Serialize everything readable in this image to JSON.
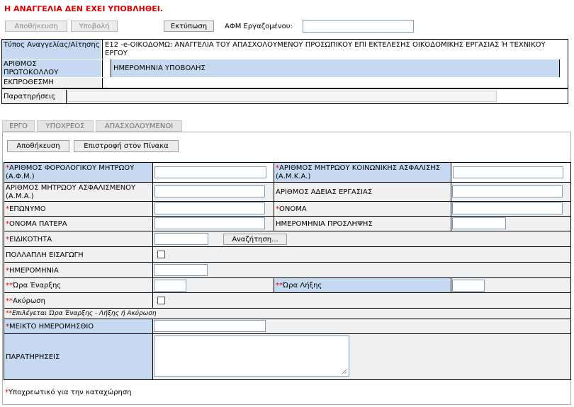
{
  "status_message": "Η ΑΝΑΓΓΕΛΙΑ ΔΕΝ ΕΧΕΙ ΥΠΟΒΛΗΘΕΙ.",
  "toolbar": {
    "save_label": "Αποθήκευση",
    "submit_label": "Υποβολή",
    "print_label": "Εκτύπωση",
    "afm_label": "ΑΦΜ Εργαζομένου:",
    "afm_value": ""
  },
  "header": {
    "type_label": "Τύπος Αναγγελίας/Αίτησης",
    "type_value": "Ε12 -e-ΟΙΚΟΔΟΜΩ: ΑΝΑΓΓΕΛΙΑ ΤΟΥ ΑΠΑΣΧΟΛΟΥΜΕΝΟΥ ΠΡΟΣΩΠΙΚΟΥ ΕΠΙ ΕΚΤΕΛΕΣΗΣ ΟΙΚΟΔΟΜΙΚΗΣ ΕΡΓΑΣΙΑΣ Ή ΤΕΧΝΙΚΟΥ ΕΡΓΟΥ",
    "protocol_label": "ΑΡΙΘΜΟΣ ΠΡΩΤΟΚΟΛΛΟΥ",
    "submission_date_label": "ΗΜΕΡΟΜΗΝΙΑ ΥΠΟΒΟΛΗΣ",
    "late_label": "ΕΚΠΡΟΘΕΣΜΗ",
    "notes_label": "Παρατηρήσεις"
  },
  "tabs": [
    "ΕΡΓΟ",
    "ΥΠΟΧΡΕΟΣ",
    "ΑΠΑΣΧΟΛΟΥΜΕΝΟΙ"
  ],
  "form_toolbar": {
    "save_label": "Αποθήκευση",
    "back_label": "Επιστροφή στον Πίνακα"
  },
  "form": {
    "afm_label": "ΑΡΙΘΜΟΣ ΦΟΡΟΛΟΓΙΚΟΥ ΜΗΤΡΩΟΥ (Α.Φ.Μ.)",
    "amka_label": "ΑΡΙΘΜΟΣ ΜΗΤΡΩΟΥ ΚΟΙΝΩΝΙΚΗΣ ΑΣΦΑΛΙΣΗΣ (Α.Μ.Κ.Α.)",
    "ama_label": "ΑΡΙΘΜΟΣ ΜΗΤΡΩΟΥ ΑΣΦΑΛΙΣΜΕΝΟΥ (Α.Μ.Α.)",
    "work_permit_label": "ΑΡΙΘΜΟΣ ΑΔΕΙΑΣ ΕΡΓΑΣΙΑΣ",
    "surname_label": "ΕΠΩΝΥΜΟ",
    "name_label": "ΟΝΟΜΑ",
    "father_name_label": "ΟΝΟΜΑ ΠΑΤΕΡΑ",
    "hire_date_label": "ΗΜΕΡΟΜΗΝΙΑ ΠΡΟΣΛΗΨΗΣ",
    "specialty_label": "ΕΙΔΙΚΟΤΗΤΑ",
    "search_label": "Αναζήτηση...",
    "multi_entry_label": "ΠΟΛΛΑΠΛΗ ΕΙΣΑΓΩΓΗ",
    "date_label": "ΗΜΕΡΟΜΗΝΙΑ",
    "start_time_label": "Ώρα Έναρξης",
    "end_time_label": "Ώρα Λήξης",
    "cancel_label": "Ακύρωση",
    "choice_note": "Επιλέγεται Ώρα Έναρξης - Λήξης ή Ακύρωση",
    "wage_label": "ΜΕΙΚΤΟ ΗΜΕΡΟΜΗΣΘΙΟ",
    "remarks_label": "ΠΑΡΑΤΗΡΗΣΕΙΣ"
  },
  "required_marker": "*",
  "double_marker": "**",
  "footer_note": "Υποχρεωτικό για την καταχώρηση",
  "colors": {
    "status_red": "#e00000",
    "label_blue": "#c5d9f1",
    "row_gray": "#f0f0f0"
  }
}
